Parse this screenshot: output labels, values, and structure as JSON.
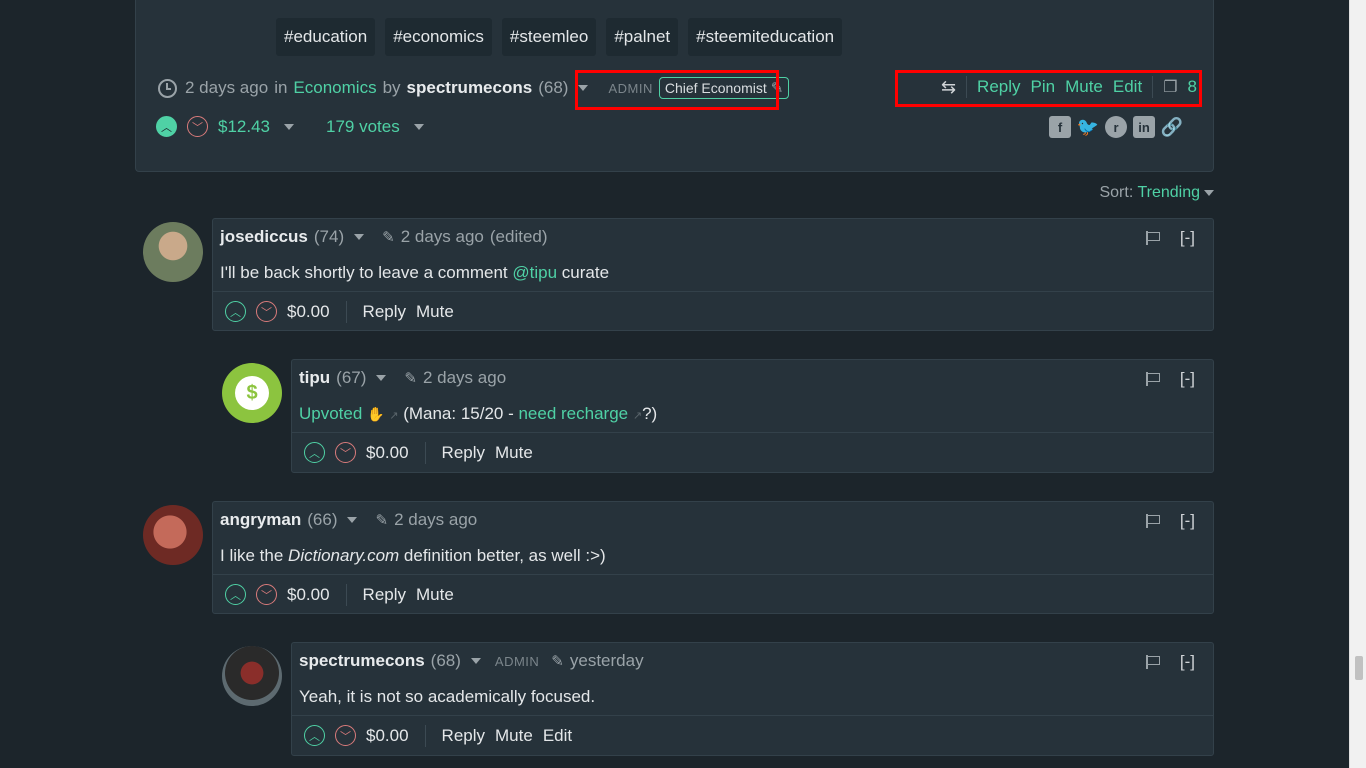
{
  "post": {
    "tags": [
      "#education",
      "#economics",
      "#steemleo",
      "#palnet",
      "#steemiteducation"
    ],
    "time": "2 days ago",
    "in_word": "in",
    "community": "Economics",
    "by_word": "by",
    "author": "spectrumecons",
    "reputation": "(68)",
    "admin_label": "ADMIN",
    "role": "Chief Economist",
    "actions": {
      "reply": "Reply",
      "pin": "Pin",
      "mute": "Mute",
      "edit": "Edit"
    },
    "comment_count": "8",
    "payout": "$12.43",
    "votes": "179 votes"
  },
  "sort": {
    "label": "Sort:",
    "value": "Trending"
  },
  "comments": [
    {
      "author": "josediccus",
      "rep": "(74)",
      "time": "2 days ago",
      "edited": "(edited)",
      "body_pre": "I'll be back shortly to leave a comment ",
      "mention": "@tipu",
      "body_post": " curate",
      "payout": "$0.00",
      "reply": "Reply",
      "mute": "Mute",
      "collapse": "[-]"
    },
    {
      "author": "tipu",
      "rep": "(67)",
      "time": "2 days ago",
      "upvoted": "Upvoted",
      "mana": "(Mana: 15/20 - ",
      "recharge": "need recharge",
      "end": "?)",
      "payout": "$0.00",
      "reply": "Reply",
      "mute": "Mute",
      "collapse": "[-]",
      "avatar_symbol": "$"
    },
    {
      "author": "angryman",
      "rep": "(66)",
      "time": "2 days ago",
      "body_pre": "I like the ",
      "body_em": "Dictionary.com",
      "body_post": " definition better, as well :>)",
      "payout": "$0.00",
      "reply": "Reply",
      "mute": "Mute",
      "collapse": "[-]"
    },
    {
      "author": "spectrumecons",
      "rep": "(68)",
      "admin": "ADMIN",
      "time": "yesterday",
      "body": "Yeah, it is not so academically focused.",
      "payout": "$0.00",
      "reply": "Reply",
      "mute": "Mute",
      "edit": "Edit",
      "collapse": "[-]"
    }
  ],
  "colors": {
    "accent": "#4fd1a5",
    "background": "#1c252b",
    "card": "#26323a",
    "highlight": "#ff0000",
    "downvote": "#d97b7b"
  }
}
